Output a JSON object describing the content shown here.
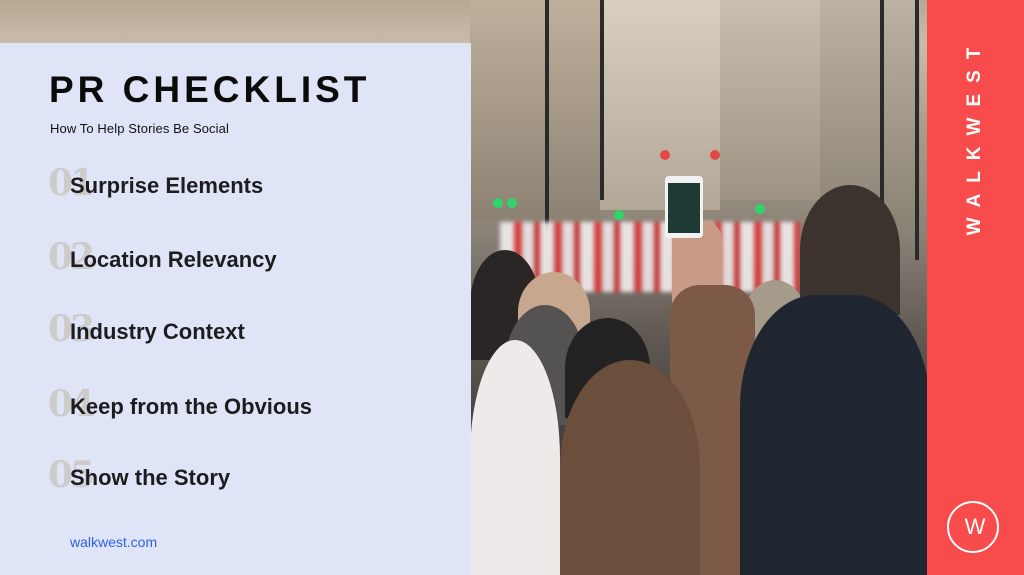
{
  "panel": {
    "title": "PR CHECKLIST",
    "subtitle": "How To Help Stories Be Social",
    "items": [
      {
        "number": "01",
        "label": "Surprise Elements"
      },
      {
        "number": "02",
        "label": "Location Relevancy"
      },
      {
        "number": "03",
        "label": "Industry Context"
      },
      {
        "number": "04",
        "label": "Keep from the Obvious"
      },
      {
        "number": "05",
        "label": "Show the Story"
      }
    ],
    "website": "walkwest.com"
  },
  "brand": {
    "name": "WALKWEST",
    "logo_letter": "W",
    "logo_icon": "walkwest-circle-logo-icon",
    "color": "#f84b4b"
  },
  "photo": {
    "subject": "crowd-photographing-parade-image"
  },
  "colors": {
    "panel_background": "#dfe4f7",
    "link": "#2e62e0",
    "number_watermark": "#cdcccb"
  }
}
